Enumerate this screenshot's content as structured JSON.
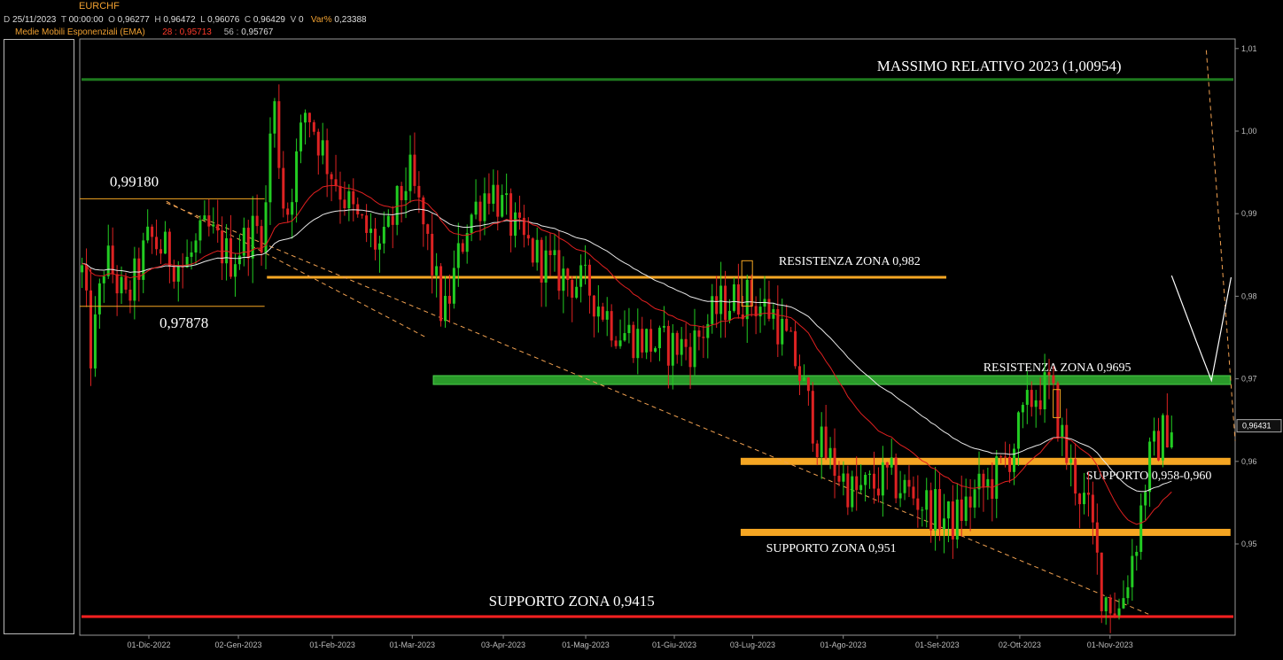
{
  "header": {
    "symbol": "EURCHF",
    "date_label": "D",
    "date": "25/11/2023",
    "time_label": "T",
    "time": "00:00:00",
    "open_label": "O",
    "open": "0,96277",
    "high_label": "H",
    "high": "0,96472",
    "low_label": "L",
    "low": "0,96076",
    "close_label": "C",
    "close": "0,96429",
    "volume_label": "V",
    "volume": "0",
    "varpct_label": "Var%",
    "varpct": "0,23388",
    "ema_label": "Medie Mobili Esponenziali (EMA)",
    "ema1_period": "28 :",
    "ema1_value": "0,95713",
    "ema2_period": "56 :",
    "ema2_value": "0,95767"
  },
  "colors": {
    "background": "#000000",
    "candle_up": "#22cc22",
    "candle_down": "#dd2222",
    "ema_fast": "#e02020",
    "ema_slow": "#e8e8e8",
    "channel": "#f0a050",
    "orange_level": "#f5a623",
    "green_level": "#2a9a2a",
    "red_level": "#ff2020",
    "dark_green_level": "#1e7a1e",
    "axis": "#888888",
    "text": "#ffffff"
  },
  "chart_data": {
    "type": "candlestick",
    "x": [
      "01-Dic-2022",
      "02-Gen-2023",
      "01-Feb-2023",
      "01-Mar-2023",
      "03-Apr-2023",
      "01-Mag-2023",
      "01-Giu-2023",
      "03-Lug-2023",
      "01-Ago-2023",
      "01-Set-2023",
      "02-Ott-2023",
      "01-Nov-2023"
    ],
    "yticks": [
      "1,01",
      "1,00",
      "0,99",
      "0,98",
      "0,97",
      "0,96",
      "0,95"
    ],
    "ylim": [
      0.939,
      1.012
    ],
    "last_price_label": "0,96431",
    "last_price": 0.96431,
    "levels": [
      {
        "value": 1.00625,
        "label": "MASSIMO RELATIVO 2023 (1,00954)",
        "style": "dark-green-thin"
      },
      {
        "value": 0.9823,
        "label": "RESISTENZA ZONA 0,982",
        "style": "orange-thin"
      },
      {
        "value": 0.96985,
        "label": "RESISTENZA ZONA 0,9695",
        "style": "green-band"
      },
      {
        "value": 0.96,
        "label": "SUPPORTO 0,958-0,960",
        "style": "orange-band"
      },
      {
        "value": 0.9514,
        "label": "SUPPORTO ZONA 0,951",
        "style": "orange-band"
      },
      {
        "value": 0.9412,
        "label": "SUPPORTO ZONA 0,9415",
        "style": "red-thin"
      }
    ],
    "range_box": {
      "high": 0.9918,
      "low": 0.97878,
      "high_label": "0,99180",
      "low_label": "0,97878"
    },
    "projection": [
      [
        0.9695,
        0.9825
      ],
      [
        0.9665,
        0.9745
      ],
      [
        0.9642,
        0.9698
      ],
      [
        0.9625,
        0.9823
      ]
    ],
    "channel": {
      "upper": [
        [
          0.975,
          1.0098
        ],
        [
          1.0,
          0.9625
        ]
      ],
      "lower": [
        [
          0.075,
          0.9913
        ],
        [
          0.925,
          0.9415
        ]
      ],
      "mid": [
        [
          0.075,
          0.9915
        ],
        [
          0.3,
          0.975
        ]
      ]
    },
    "series": [
      {
        "name": "28 :",
        "type": "ema"
      },
      {
        "name": "56 :",
        "type": "ema"
      }
    ]
  }
}
